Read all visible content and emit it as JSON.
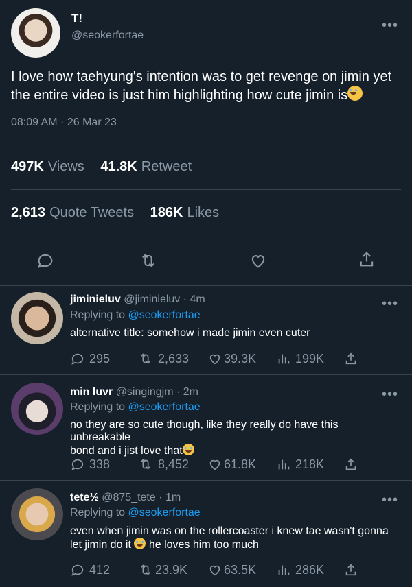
{
  "tweet": {
    "author_name": "T!",
    "author_handle": "@seokerfortae",
    "text_before_emoji": "I love how taehyung's intention was to get revenge on jimin yet the entire video is just him highlighting how cute jimin is",
    "timestamp": "08:09 AM · 26 Mar 23",
    "stats": {
      "views_num": "497K",
      "views_label": "Views",
      "retweets_num": "41.8K",
      "retweets_label": "Retweet",
      "quotes_num": "2,613",
      "quotes_label": "Quote Tweets",
      "likes_num": "186K",
      "likes_label": "Likes"
    }
  },
  "replies": [
    {
      "name": "jiminieluv",
      "handle": "@jiminieluv · 4m",
      "replying_to_label": "Replying to",
      "replying_to_handle": "@seokerfortae",
      "text": "alternative title: somehow i made jimin even cuter",
      "reply_count": "295",
      "retweet_count": "2,633",
      "like_count": "39.3K",
      "view_count": "199K"
    },
    {
      "name": "min luvr",
      "handle": "@singingjm · 2m",
      "replying_to_label": "Replying to",
      "replying_to_handle": "@seokerfortae",
      "text_line1": "no they are so cute though, like they really do have this unbreakable",
      "text_line2": "bond and i jist love that",
      "reply_count": "338",
      "retweet_count": "8,452",
      "like_count": "61.8K",
      "view_count": "218K"
    },
    {
      "name": "tete½",
      "handle": "@875_tete · 1m",
      "replying_to_label": "Replying to",
      "replying_to_handle": "@seokerfortae",
      "text_line1": "even when jimin was on the rollercoaster i knew tae wasn't gonna",
      "text_line2a": "let jimin do it",
      "text_line2b": "he loves him too much",
      "reply_count": "412",
      "retweet_count": "23.9K",
      "like_count": "63.5K",
      "view_count": "286K"
    }
  ],
  "more_glyph": "•••",
  "colors": {
    "background": "#15202b",
    "muted": "#8b98a5",
    "link": "#1d9bf0",
    "divider": "#38444d"
  }
}
